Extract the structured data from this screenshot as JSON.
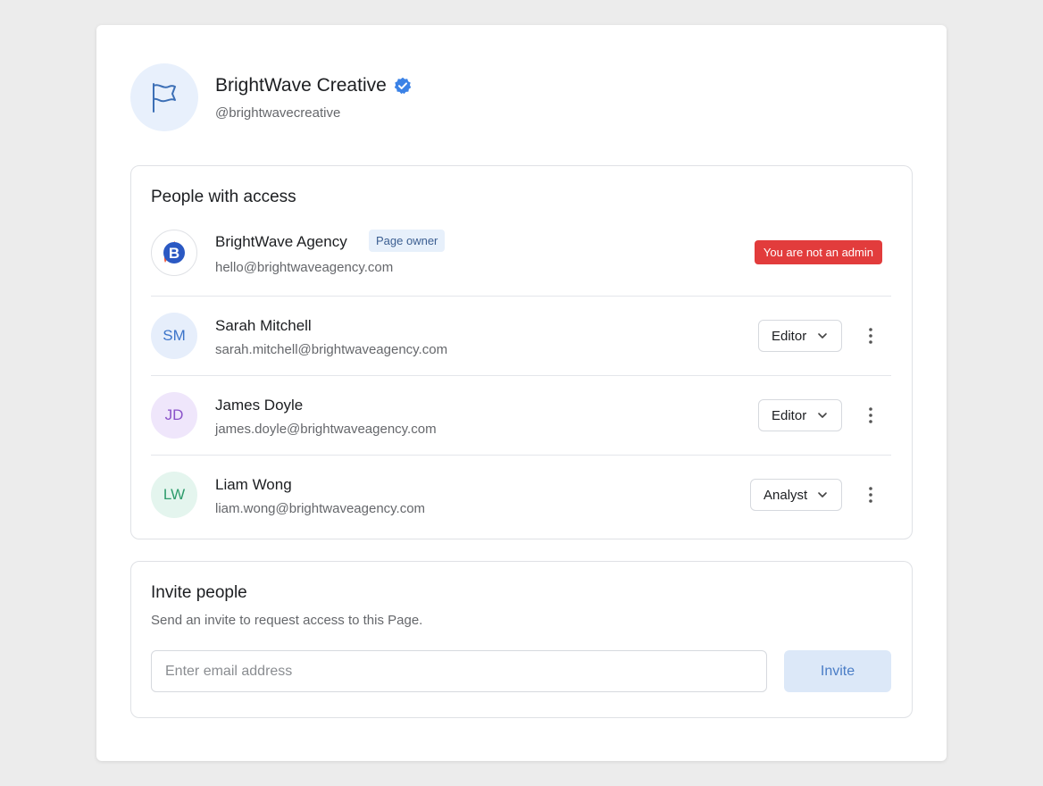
{
  "page": {
    "name": "BrightWave Creative",
    "handle": "@brightwavecreative",
    "avatar_icon": "flag-icon",
    "verified_icon": "verified-badge-icon"
  },
  "access": {
    "title": "People with access",
    "owner": {
      "name": "BrightWave Agency",
      "email": "hello@brightwaveagency.com",
      "badge": "Page owner",
      "logo_text": "B",
      "admin_notice": "You are not an admin"
    },
    "members": [
      {
        "initials": "SM",
        "name": "Sarah Mitchell",
        "email": "sarah.mitchell@brightwaveagency.com",
        "role": "Editor",
        "avatar_bg": "#e6eefb",
        "avatar_fg": "#3c74c9"
      },
      {
        "initials": "JD",
        "name": "James Doyle",
        "email": "james.doyle@brightwaveagency.com",
        "role": "Editor",
        "avatar_bg": "#efe6fb",
        "avatar_fg": "#8a52c9"
      },
      {
        "initials": "LW",
        "name": "Liam Wong",
        "email": "liam.wong@brightwaveagency.com",
        "role": "Analyst",
        "avatar_bg": "#e4f5ee",
        "avatar_fg": "#2e9c6c"
      }
    ]
  },
  "invite": {
    "title": "Invite people",
    "subtitle": "Send an invite to request access to this Page.",
    "placeholder": "Enter email address",
    "button_label": "Invite"
  },
  "colors": {
    "accent": "#3b82e6",
    "danger": "#e23c3c",
    "invite_button_bg": "#dce8f8"
  }
}
